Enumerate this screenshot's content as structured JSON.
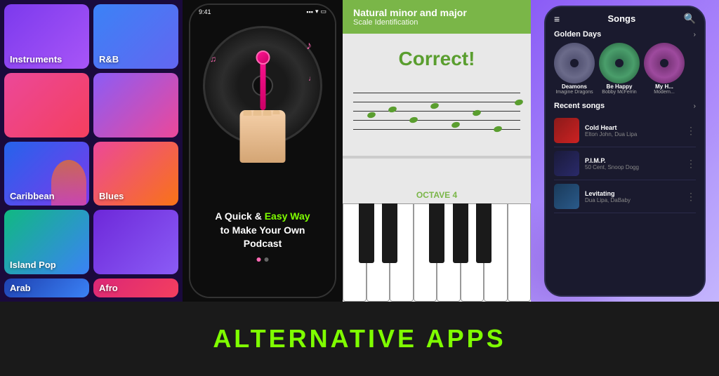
{
  "banner": {
    "text": "ALTERNATIVE APPS"
  },
  "panel1": {
    "categories": [
      {
        "label": "Instruments",
        "style": "instruments"
      },
      {
        "label": "R&B",
        "style": "rb"
      },
      {
        "label": "",
        "style": "something"
      },
      {
        "label": "",
        "style": "rnb2"
      },
      {
        "label": "Caribbean",
        "style": "caribbean"
      },
      {
        "label": "Blues",
        "style": "blues"
      },
      {
        "label": "Island Pop",
        "style": "island"
      },
      {
        "label": "",
        "style": "blank"
      },
      {
        "label": "Arab",
        "style": "arab"
      },
      {
        "label": "Afro",
        "style": "afro"
      }
    ]
  },
  "panel2": {
    "time": "9:41",
    "headline_line1": "A Quick &",
    "headline_highlight": "Easy Way",
    "headline_line2": "to Make Your Own",
    "headline_line3": "Podcast"
  },
  "panel3": {
    "header_title": "Natural minor and major",
    "header_subtitle": "Scale Identification",
    "correct_text": "Correct!",
    "octave_label": "OCTAVE 4"
  },
  "panel4": {
    "title": "Songs",
    "golden_days_label": "Golden Days",
    "albums": [
      {
        "name": "Deamons",
        "artist": "Imagine Dragons",
        "style": "album-disc-1"
      },
      {
        "name": "Be Happy",
        "artist": "Bobby McFerrin",
        "style": "album-disc-2"
      },
      {
        "name": "My H...",
        "artist": "Modern...",
        "style": "album-disc-3"
      }
    ],
    "recent_songs_label": "Recent songs",
    "songs": [
      {
        "name": "Cold Heart",
        "artist": "Elton John, Dua Lipa",
        "style": "song-thumb-1"
      },
      {
        "name": "P.I.M.P.",
        "artist": "50 Cent, Snoop Dogg",
        "style": "song-thumb-2"
      },
      {
        "name": "Levitating",
        "artist": "Dua Lipa, DaBaby",
        "style": "song-thumb-3"
      }
    ]
  }
}
